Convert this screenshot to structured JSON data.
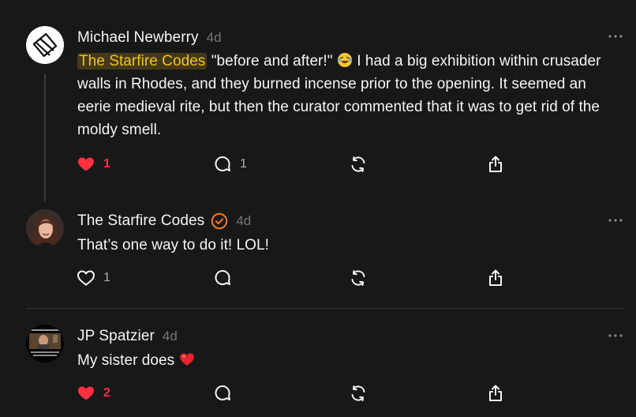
{
  "colors": {
    "background": "#181818",
    "text": "#f3f5f7",
    "muted": "#777777",
    "like_active": "#ff3040",
    "mention": "#f0c419",
    "verified": "#f07b24"
  },
  "comments": [
    {
      "author": "Michael Newberry",
      "time": "4d",
      "mention": "The Starfire Codes",
      "text": " \"before and after!\" ",
      "text_after_emoji": " I had a big exhibition within crusader walls in Rhodes, and they burned incense prior to the opening. It seemed an eerie medieval rite, but then the curator commented that it was to get rid of the moldy smell.",
      "emoji": "laughing-emoji",
      "liked": true,
      "likes": "1",
      "replies": "1",
      "avatar_icon": "diamond-logo-icon"
    },
    {
      "author": "The Starfire Codes",
      "time": "4d",
      "verified": true,
      "text": "That’s one way to do it! LOL!",
      "liked": false,
      "likes": "1",
      "avatar_icon": "woman-portrait-avatar"
    },
    {
      "author": "JP Spatzier",
      "time": "4d",
      "text": "My sister does ",
      "emoji": "red-heart-emoji",
      "liked": true,
      "likes": "2",
      "avatar_icon": "meme-thumbnail-avatar"
    }
  ]
}
